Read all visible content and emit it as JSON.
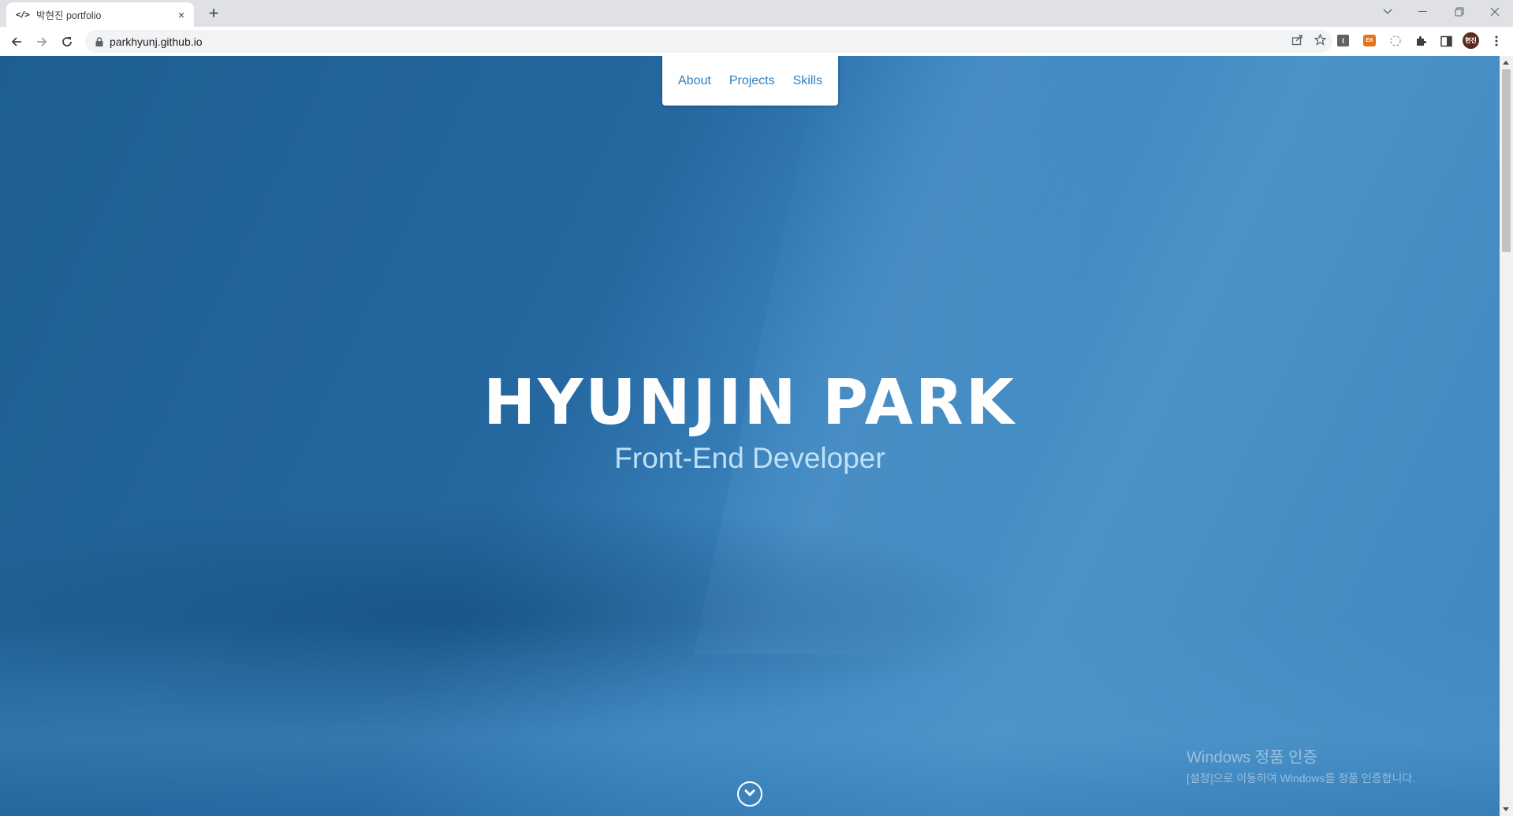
{
  "browser": {
    "tab": {
      "favicon_text": "</>",
      "title": "박현진 portfolio",
      "close_glyph": "×"
    },
    "new_tab_glyph": "+",
    "url": "parkhyunj.github.io",
    "profile_initials": "현진",
    "extensions": [
      {
        "name": "extension-1",
        "text": "I",
        "color": "#5f6368"
      },
      {
        "name": "extension-2",
        "text": "EX",
        "color": "#e8711c"
      }
    ]
  },
  "nav": {
    "items": [
      {
        "label": "About"
      },
      {
        "label": "Projects"
      },
      {
        "label": "Skills"
      }
    ]
  },
  "hero": {
    "title": "HYUNJIN PARK",
    "subtitle": "Front-End Developer"
  },
  "activation": {
    "title": "Windows 정품 인증",
    "subtitle": "[설정]으로 이동하여 Windows를 정품 인증합니다."
  },
  "colors": {
    "accent": "#2c7fc0",
    "hero_blue": "#2568a0"
  }
}
